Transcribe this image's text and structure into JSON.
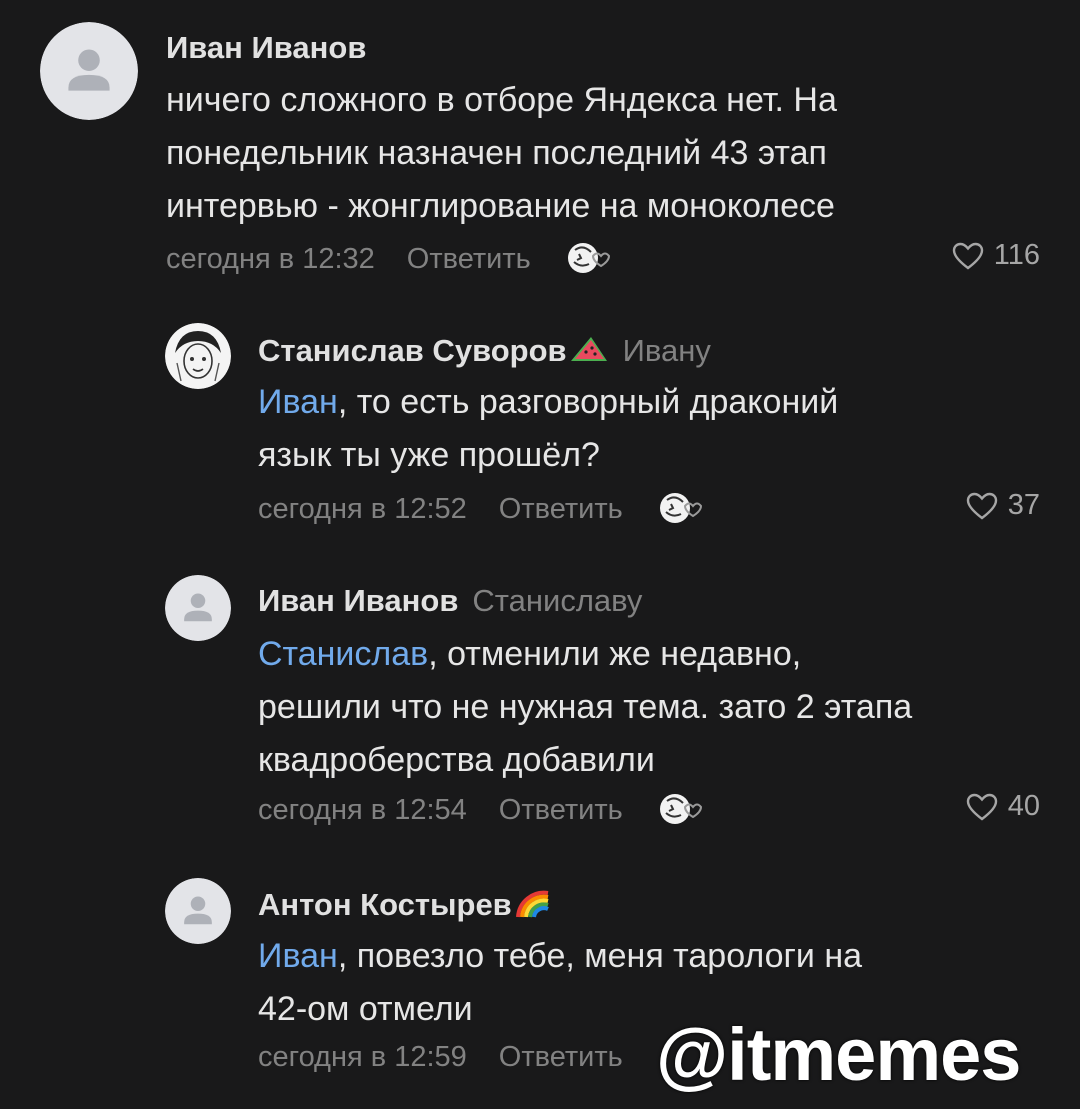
{
  "comments": [
    {
      "author": "Иван Иванов",
      "reply_to": "",
      "mention": "",
      "text": "ничего сложного в отборе Яндекса нет. На\nпонедельник назначен последний 43 этап\nинтервью - жонглирование на моноколесе",
      "time": "сегодня в 12:32",
      "reply_label": "Ответить",
      "likes": "116",
      "avatar_icon": "default-user-icon"
    },
    {
      "author": "Станислав Суворов",
      "author_emoji": "watermelon-icon",
      "reply_to": "Ивану",
      "mention": "Иван",
      "text": ", то есть разговорный драконий\nязык ты уже прошёл?",
      "time": "сегодня в 12:52",
      "reply_label": "Ответить",
      "likes": "37",
      "avatar_icon": "sketch-portrait-icon"
    },
    {
      "author": "Иван Иванов",
      "reply_to": "Станиславу",
      "mention": "Станислав",
      "text": ", отменили же недавно,\nрешили что не нужная тема. зато 2 этапа\nквадроберства добавили",
      "time": "сегодня в 12:54",
      "reply_label": "Ответить",
      "likes": "40",
      "avatar_icon": "default-user-icon"
    },
    {
      "author": "Антон Костырев",
      "author_emoji": "rainbow-icon",
      "reply_to": "",
      "mention": "Иван",
      "text": ", повезло тебе, меня тарологи на\n42-ом отмели",
      "time": "сегодня в 12:59",
      "reply_label": "Ответить",
      "likes": "",
      "avatar_icon": "default-user-icon"
    }
  ],
  "watermark": "@itmemes",
  "colors": {
    "background": "#19191a",
    "mention": "#71aaeb",
    "secondary_text": "#828282",
    "avatar_placeholder": "#e3e4e8"
  }
}
